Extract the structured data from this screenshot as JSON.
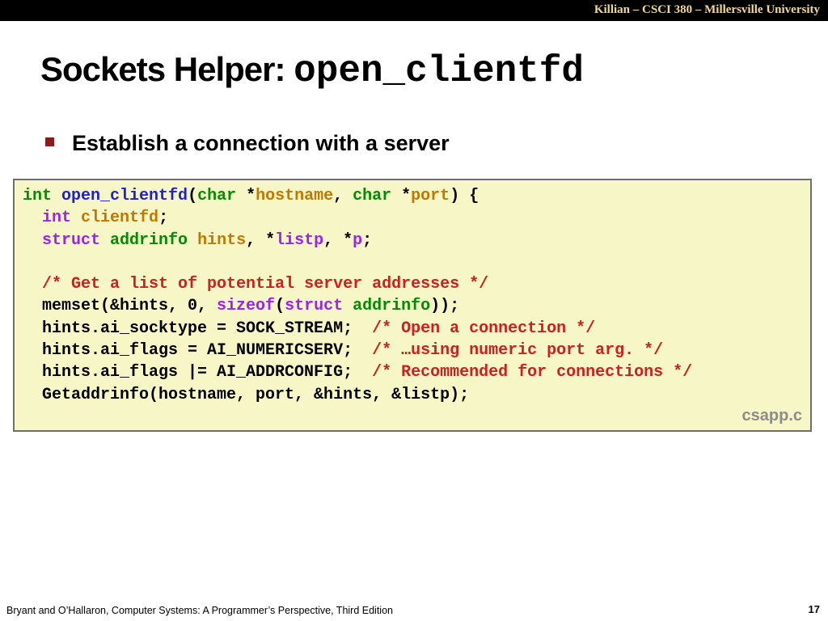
{
  "header": {
    "course_label": "Killian – CSCI 380 – Millersville University"
  },
  "slide": {
    "title_text": "Sockets Helper: ",
    "title_code": "open_clientfd",
    "bullet": "Establish a connection with a server",
    "code_source": "csapp.c",
    "code_lines": [
      [
        {
          "t": "int",
          "c": "kw"
        },
        {
          "t": " ",
          "c": "txt"
        },
        {
          "t": "open_clientfd",
          "c": "fn"
        },
        {
          "t": "(",
          "c": "txt"
        },
        {
          "t": "char",
          "c": "kw"
        },
        {
          "t": " *",
          "c": "txt"
        },
        {
          "t": "hostname",
          "c": "var"
        },
        {
          "t": ", ",
          "c": "txt"
        },
        {
          "t": "char",
          "c": "kw"
        },
        {
          "t": " *",
          "c": "txt"
        },
        {
          "t": "port",
          "c": "var"
        },
        {
          "t": ") {",
          "c": "txt"
        }
      ],
      [
        {
          "t": "  ",
          "c": "txt"
        },
        {
          "t": "int",
          "c": "kw2"
        },
        {
          "t": " ",
          "c": "txt"
        },
        {
          "t": "clientfd",
          "c": "var"
        },
        {
          "t": ";",
          "c": "txt"
        }
      ],
      [
        {
          "t": "  ",
          "c": "txt"
        },
        {
          "t": "struct",
          "c": "kw2"
        },
        {
          "t": " ",
          "c": "txt"
        },
        {
          "t": "addrinfo",
          "c": "kw"
        },
        {
          "t": " ",
          "c": "txt"
        },
        {
          "t": "hints",
          "c": "var"
        },
        {
          "t": ", *",
          "c": "txt"
        },
        {
          "t": "listp",
          "c": "kw2"
        },
        {
          "t": ", *",
          "c": "txt"
        },
        {
          "t": "p",
          "c": "kw2"
        },
        {
          "t": ";",
          "c": "txt"
        }
      ],
      [],
      [
        {
          "t": "  ",
          "c": "txt"
        },
        {
          "t": "/* Get a list of potential server addresses */",
          "c": "cm"
        }
      ],
      [
        {
          "t": "  memset(&hints, 0, ",
          "c": "txt"
        },
        {
          "t": "sizeof",
          "c": "kw2"
        },
        {
          "t": "(",
          "c": "txt"
        },
        {
          "t": "struct",
          "c": "kw2"
        },
        {
          "t": " ",
          "c": "txt"
        },
        {
          "t": "addrinfo",
          "c": "kw"
        },
        {
          "t": "));",
          "c": "txt"
        }
      ],
      [
        {
          "t": "  hints.ai_socktype = SOCK_STREAM;  ",
          "c": "txt"
        },
        {
          "t": "/* Open a connection */",
          "c": "cm"
        }
      ],
      [
        {
          "t": "  hints.ai_flags = AI_NUMERICSERV;  ",
          "c": "txt"
        },
        {
          "t": "/* …using numeric port arg. */",
          "c": "cm"
        }
      ],
      [
        {
          "t": "  hints.ai_flags |= AI_ADDRCONFIG;  ",
          "c": "txt"
        },
        {
          "t": "/* Recommended for connections */",
          "c": "cm"
        }
      ],
      [
        {
          "t": "  Getaddrinfo(hostname, port, &hints, &listp);",
          "c": "txt"
        }
      ]
    ]
  },
  "footer": {
    "citation": "Bryant and O’Hallaron, Computer Systems: A Programmer’s Perspective, Third Edition",
    "page_number": "17"
  },
  "colors": {
    "top_bar": "#000000",
    "course_label": "#f3d98a",
    "code_background": "#f7f6c6",
    "bullet_marker": "#8b1a1a",
    "keyword_green": "#008c00",
    "keyword_purple": "#a020f0",
    "function_blue": "#1f1fcf",
    "identifier_orange": "#c07800",
    "comment_red": "#cc2020",
    "source_file_gray": "#8c8c8c"
  }
}
